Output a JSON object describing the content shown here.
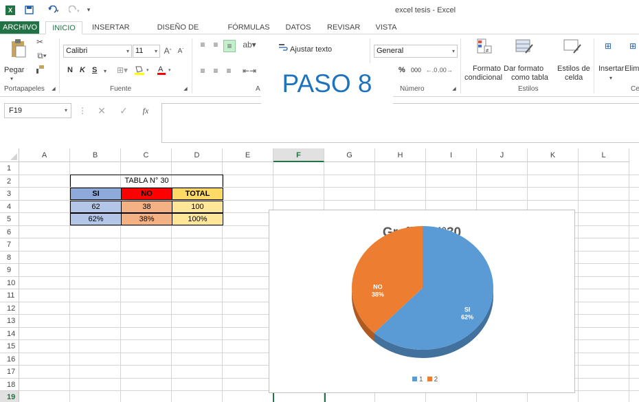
{
  "window": {
    "title": "excel tesis - Excel",
    "app_icon": "excel-logo-icon"
  },
  "tabs": [
    "ARCHIVO",
    "INICIO",
    "INSERTAR",
    "DISEÑO DE PÁGINA",
    "FÓRMULAS",
    "DATOS",
    "REVISAR",
    "VISTA"
  ],
  "active_tab": "INICIO",
  "ribbon": {
    "paste_label": "Pegar",
    "clipboard_group": "Portapapeles",
    "font_name": "Calibri",
    "font_size": "11",
    "bold": "N",
    "italic": "K",
    "underline": "S",
    "font_group": "Fuente",
    "wrap_text": "Ajustar texto",
    "number_format": "General",
    "number_group": "Número",
    "percent": "%",
    "thousands": "000",
    "cond_format_1": "Formato",
    "cond_format_2": "condicional",
    "table_format_1": "Dar formato",
    "table_format_2": "como tabla",
    "cell_styles_1": "Estilos de",
    "cell_styles_2": "celda",
    "styles_group": "Estilos",
    "insert_label": "Insertar",
    "delete_label": "Elim",
    "cells_group_partial": "Ce",
    "alignment_group_partial": "A"
  },
  "overlay_text": "PASO 8",
  "formula_bar": {
    "name_box": "F19",
    "fx": "fx",
    "content": ""
  },
  "columns": [
    "A",
    "B",
    "C",
    "D",
    "E",
    "F",
    "G",
    "H",
    "I",
    "J",
    "K",
    "L"
  ],
  "selected_column": "F",
  "rows": [
    "1",
    "2",
    "3",
    "4",
    "5",
    "6",
    "7",
    "8",
    "9",
    "10",
    "11",
    "12",
    "13",
    "14",
    "15",
    "16",
    "17",
    "18",
    "19"
  ],
  "selected_row": "19",
  "table": {
    "title": "TABLA N° 30",
    "headers": [
      "SI",
      "NO",
      "TOTAL"
    ],
    "counts": [
      "62",
      "38",
      "100"
    ],
    "percents": [
      "62%",
      "38%",
      "100%"
    ],
    "colors": {
      "si_header": "#8eaadb",
      "no_header": "#ff0000",
      "total_header": "#ffd966",
      "si_cell": "#b4c6e7",
      "no_cell": "#f4b183",
      "total_cell": "#ffe699"
    }
  },
  "chart_data": {
    "type": "pie",
    "title": "Grafico N°30",
    "categories": [
      "SI",
      "NO"
    ],
    "values": [
      62,
      38
    ],
    "data_labels": [
      {
        "name": "SI",
        "pct": "62%"
      },
      {
        "name": "NO",
        "pct": "38%"
      }
    ],
    "legend": [
      "1",
      "2"
    ],
    "legend_position": "bottom",
    "colors": [
      "#5b9bd5",
      "#ed7d31"
    ],
    "style": "3d"
  }
}
